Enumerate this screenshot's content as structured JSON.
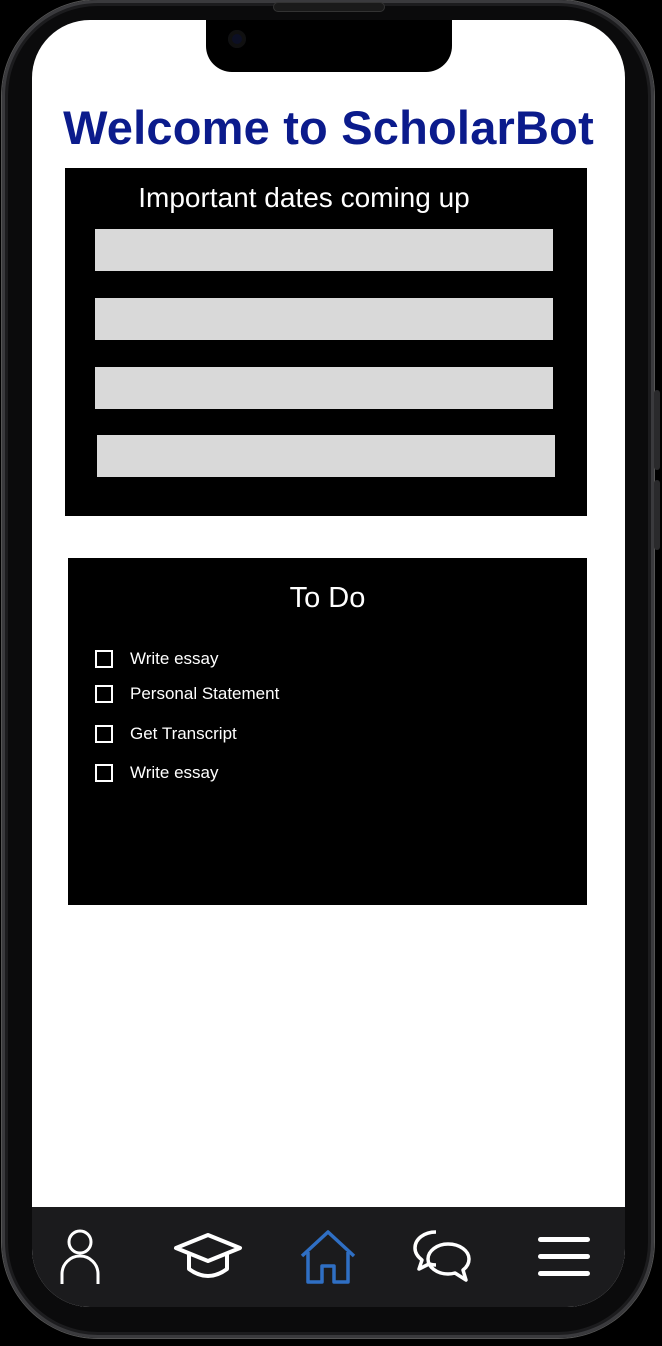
{
  "app": {
    "title": "Welcome to ScholarBot"
  },
  "dates_panel": {
    "title": "Important dates coming up",
    "rows": [
      "",
      "",
      "",
      ""
    ]
  },
  "todo_panel": {
    "title": "To Do",
    "items": [
      {
        "label": "Write essay",
        "checked": false
      },
      {
        "label": "Personal Statement",
        "checked": false
      },
      {
        "label": "Get Transcript",
        "checked": false
      },
      {
        "label": "Write essay",
        "checked": false
      }
    ]
  },
  "tabbar": {
    "tabs": [
      {
        "icon": "profile-icon",
        "active": false
      },
      {
        "icon": "graduation-cap-icon",
        "active": false
      },
      {
        "icon": "home-icon",
        "active": true
      },
      {
        "icon": "chat-bubbles-icon",
        "active": false
      },
      {
        "icon": "menu-icon",
        "active": false
      }
    ],
    "colors": {
      "background": "#1b1b1d",
      "icon": "#ffffff",
      "active_icon": "#2f6fc4"
    }
  },
  "colors": {
    "title": "#0b1b8c",
    "panel_background": "#000000",
    "date_row": "#d9d9d9"
  }
}
